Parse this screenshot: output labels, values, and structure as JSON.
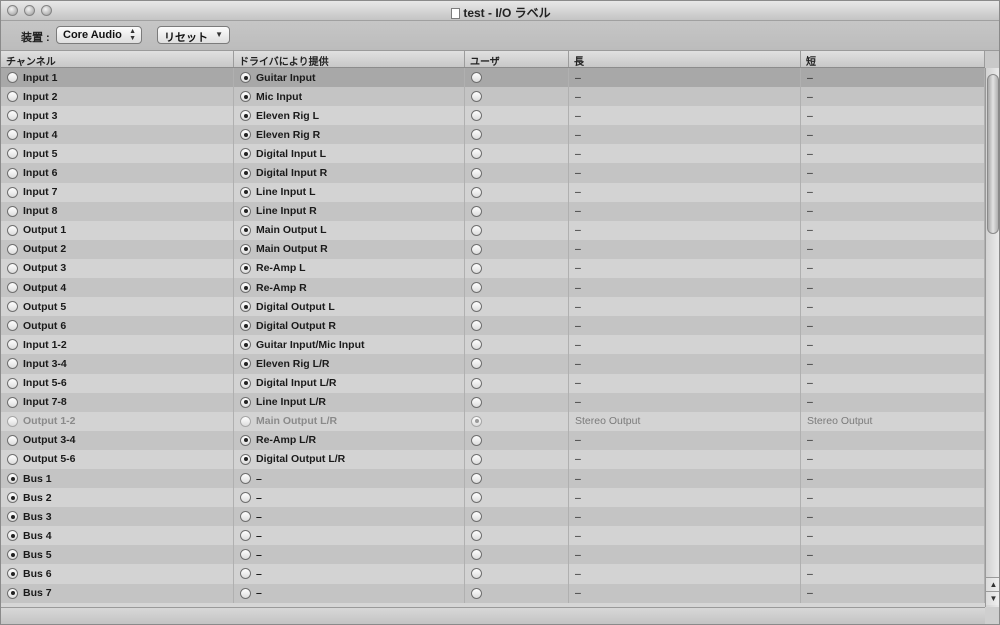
{
  "window": {
    "title": "test - I/O ラベル"
  },
  "toolbar": {
    "device_label": "装置 :",
    "device_value": "Core Audio",
    "reset_label": "リセット"
  },
  "columns": [
    "チャンネル",
    "ドライバにより提供",
    "ユーザ",
    "長",
    "短"
  ],
  "rows": [
    {
      "channel": "Input 1",
      "channel_on": false,
      "driver": "Guitar Input",
      "driver_on": true,
      "user_on": false,
      "long": "–",
      "short": "–",
      "selected": true,
      "dim": false
    },
    {
      "channel": "Input 2",
      "channel_on": false,
      "driver": "Mic Input",
      "driver_on": true,
      "user_on": false,
      "long": "–",
      "short": "–",
      "selected": false,
      "dim": false
    },
    {
      "channel": "Input 3",
      "channel_on": false,
      "driver": "Eleven Rig L",
      "driver_on": true,
      "user_on": false,
      "long": "–",
      "short": "–",
      "selected": false,
      "dim": false
    },
    {
      "channel": "Input 4",
      "channel_on": false,
      "driver": "Eleven Rig R",
      "driver_on": true,
      "user_on": false,
      "long": "–",
      "short": "–",
      "selected": false,
      "dim": false
    },
    {
      "channel": "Input 5",
      "channel_on": false,
      "driver": "Digital Input L",
      "driver_on": true,
      "user_on": false,
      "long": "–",
      "short": "–",
      "selected": false,
      "dim": false
    },
    {
      "channel": "Input 6",
      "channel_on": false,
      "driver": "Digital Input R",
      "driver_on": true,
      "user_on": false,
      "long": "–",
      "short": "–",
      "selected": false,
      "dim": false
    },
    {
      "channel": "Input 7",
      "channel_on": false,
      "driver": "Line Input L",
      "driver_on": true,
      "user_on": false,
      "long": "–",
      "short": "–",
      "selected": false,
      "dim": false
    },
    {
      "channel": "Input 8",
      "channel_on": false,
      "driver": "Line Input R",
      "driver_on": true,
      "user_on": false,
      "long": "–",
      "short": "–",
      "selected": false,
      "dim": false
    },
    {
      "channel": "Output 1",
      "channel_on": false,
      "driver": "Main Output L",
      "driver_on": true,
      "user_on": false,
      "long": "–",
      "short": "–",
      "selected": false,
      "dim": false
    },
    {
      "channel": "Output 2",
      "channel_on": false,
      "driver": "Main Output R",
      "driver_on": true,
      "user_on": false,
      "long": "–",
      "short": "–",
      "selected": false,
      "dim": false
    },
    {
      "channel": "Output 3",
      "channel_on": false,
      "driver": "Re-Amp L",
      "driver_on": true,
      "user_on": false,
      "long": "–",
      "short": "–",
      "selected": false,
      "dim": false
    },
    {
      "channel": "Output 4",
      "channel_on": false,
      "driver": "Re-Amp R",
      "driver_on": true,
      "user_on": false,
      "long": "–",
      "short": "–",
      "selected": false,
      "dim": false
    },
    {
      "channel": "Output 5",
      "channel_on": false,
      "driver": "Digital Output L",
      "driver_on": true,
      "user_on": false,
      "long": "–",
      "short": "–",
      "selected": false,
      "dim": false
    },
    {
      "channel": "Output 6",
      "channel_on": false,
      "driver": "Digital Output R",
      "driver_on": true,
      "user_on": false,
      "long": "–",
      "short": "–",
      "selected": false,
      "dim": false
    },
    {
      "channel": "Input 1-2",
      "channel_on": false,
      "driver": "Guitar Input/Mic Input",
      "driver_on": true,
      "user_on": false,
      "long": "–",
      "short": "–",
      "selected": false,
      "dim": false
    },
    {
      "channel": "Input 3-4",
      "channel_on": false,
      "driver": "Eleven Rig L/R",
      "driver_on": true,
      "user_on": false,
      "long": "–",
      "short": "–",
      "selected": false,
      "dim": false
    },
    {
      "channel": "Input 5-6",
      "channel_on": false,
      "driver": "Digital Input L/R",
      "driver_on": true,
      "user_on": false,
      "long": "–",
      "short": "–",
      "selected": false,
      "dim": false
    },
    {
      "channel": "Input 7-8",
      "channel_on": false,
      "driver": "Line Input L/R",
      "driver_on": true,
      "user_on": false,
      "long": "–",
      "short": "–",
      "selected": false,
      "dim": false
    },
    {
      "channel": "Output 1-2",
      "channel_on": false,
      "driver": "Main Output L/R",
      "driver_on": false,
      "user_on": true,
      "long": "Stereo Output",
      "short": "Stereo Output",
      "selected": false,
      "dim": true
    },
    {
      "channel": "Output 3-4",
      "channel_on": false,
      "driver": "Re-Amp L/R",
      "driver_on": true,
      "user_on": false,
      "long": "–",
      "short": "–",
      "selected": false,
      "dim": false
    },
    {
      "channel": "Output 5-6",
      "channel_on": false,
      "driver": "Digital Output L/R",
      "driver_on": true,
      "user_on": false,
      "long": "–",
      "short": "–",
      "selected": false,
      "dim": false
    },
    {
      "channel": "Bus 1",
      "channel_on": true,
      "driver": "–",
      "driver_on": false,
      "user_on": false,
      "long": "–",
      "short": "–",
      "selected": false,
      "dim": false
    },
    {
      "channel": "Bus 2",
      "channel_on": true,
      "driver": "–",
      "driver_on": false,
      "user_on": false,
      "long": "–",
      "short": "–",
      "selected": false,
      "dim": false
    },
    {
      "channel": "Bus 3",
      "channel_on": true,
      "driver": "–",
      "driver_on": false,
      "user_on": false,
      "long": "–",
      "short": "–",
      "selected": false,
      "dim": false
    },
    {
      "channel": "Bus 4",
      "channel_on": true,
      "driver": "–",
      "driver_on": false,
      "user_on": false,
      "long": "–",
      "short": "–",
      "selected": false,
      "dim": false
    },
    {
      "channel": "Bus 5",
      "channel_on": true,
      "driver": "–",
      "driver_on": false,
      "user_on": false,
      "long": "–",
      "short": "–",
      "selected": false,
      "dim": false
    },
    {
      "channel": "Bus 6",
      "channel_on": true,
      "driver": "–",
      "driver_on": false,
      "user_on": false,
      "long": "–",
      "short": "–",
      "selected": false,
      "dim": false
    },
    {
      "channel": "Bus 7",
      "channel_on": true,
      "driver": "–",
      "driver_on": false,
      "user_on": false,
      "long": "–",
      "short": "–",
      "selected": false,
      "dim": false
    }
  ]
}
